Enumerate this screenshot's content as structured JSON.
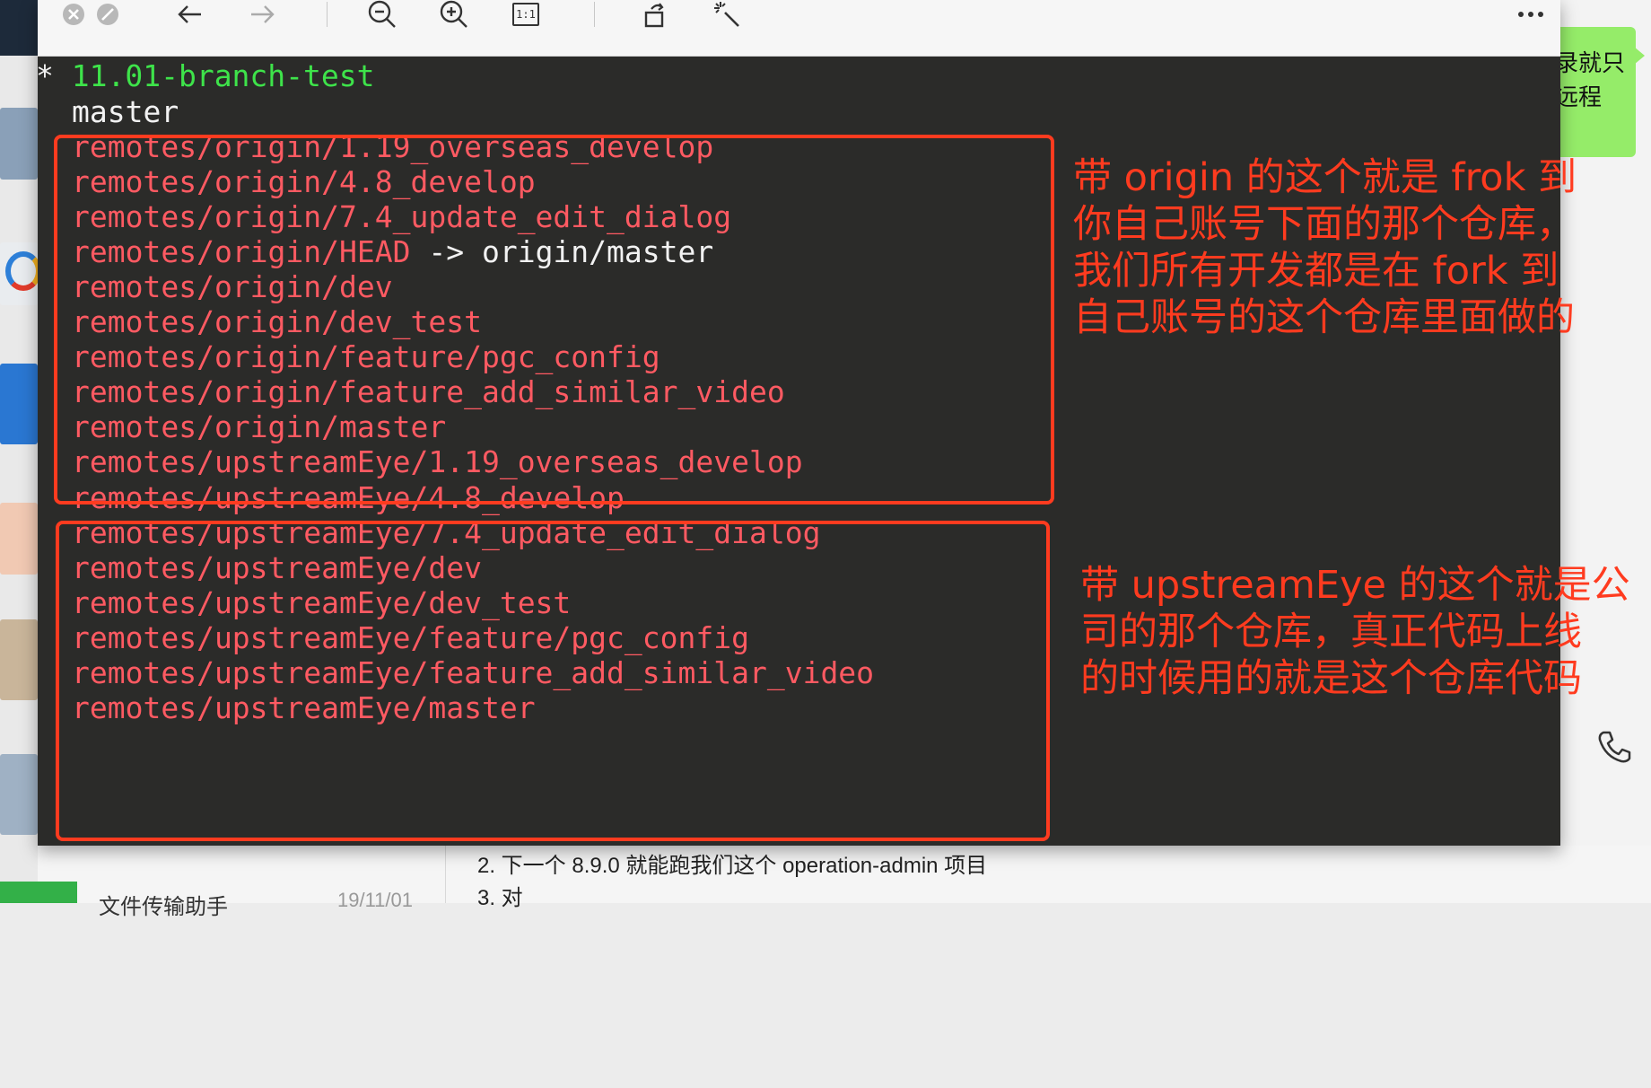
{
  "viewer": {
    "toolbar": {
      "close_icon": "close-circle-icon",
      "minimize_icon": "minimize-circle-icon",
      "back_icon": "arrow-left-icon",
      "forward_icon": "arrow-right-icon",
      "zoom_out_icon": "zoom-out-icon",
      "zoom_in_icon": "zoom-in-icon",
      "actual_size_icon": "actual-size-icon",
      "rotate_icon": "rotate-icon",
      "enhance_icon": "magic-wand-icon",
      "more_icon": "more-dots-icon",
      "actual_size_label": "1:1"
    },
    "terminal": {
      "current_branch_marker": "*",
      "current_branch": "11.01-branch-test",
      "master": "master",
      "origin_branches": [
        "remotes/origin/1.19_overseas_develop",
        "remotes/origin/4.8_develop",
        "remotes/origin/7.4_update_edit_dialog",
        "remotes/origin/HEAD",
        "remotes/origin/dev",
        "remotes/origin/dev_test",
        "remotes/origin/feature/pgc_config",
        "remotes/origin/feature_add_similar_video",
        "remotes/origin/master"
      ],
      "head_arrow": " -> origin/master",
      "upstream_branches": [
        "remotes/upstreamEye/1.19_overseas_develop",
        "remotes/upstreamEye/4.8_develop",
        "remotes/upstreamEye/7.4_update_edit_dialog",
        "remotes/upstreamEye/dev",
        "remotes/upstreamEye/dev_test",
        "remotes/upstreamEye/feature/pgc_config",
        "remotes/upstreamEye/feature_add_similar_video",
        "remotes/upstreamEye/master"
      ]
    },
    "annotations": {
      "origin_note": "带 origin 的这个就是 frok 到\n你自己账号下面的那个仓库，\n我们所有开发都是在 fork 到\n自己账号的这个仓库里面做的",
      "upstream_note": "带 upstreamEye 的这个就是公\n司的那个仓库，真正代码上线\n的时候用的就是这个仓库代码"
    }
  },
  "background": {
    "bubble_line1": "录就只",
    "bubble_line2": "远程",
    "message_line1": "2. 下一个 8.9.0 就能跑我们这个 operation-admin 项目",
    "message_line2": "3. 对",
    "contact_name": "文件传输助手",
    "contact_date": "19/11/01",
    "phone_icon": "phone-icon"
  },
  "colors": {
    "terminal_bg": "#2b2b29",
    "current_branch": "#3ee34a",
    "remote_branch": "#ff5a62",
    "annotation": "#ff3b1f",
    "chat_bubble": "#95ec69"
  }
}
